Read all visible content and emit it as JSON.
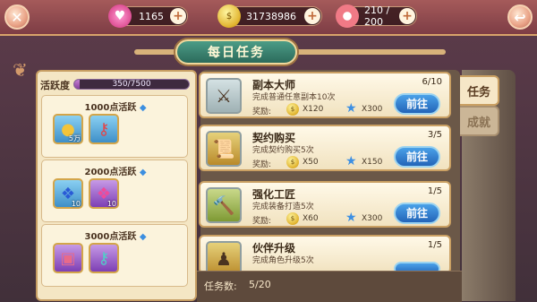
{
  "top_bar": {
    "close_icon": "close-icon",
    "back_icon": "back-icon",
    "resources": [
      {
        "icon": "heart-gem-icon",
        "value": "1165"
      },
      {
        "icon": "gold-coin-icon",
        "value": "31738986"
      },
      {
        "icon": "donut-stamina-icon",
        "value": "210 / 200"
      }
    ]
  },
  "panel": {
    "title": "每日任务"
  },
  "activity": {
    "label": "活跃度",
    "progress_text": "350/7500",
    "progress_fraction": 0.047,
    "tiers": [
      {
        "label": "1000点活跃",
        "items": [
          {
            "icon": "gold-medal-icon",
            "count": "5万"
          },
          {
            "icon": "red-key-icon",
            "count": ""
          }
        ]
      },
      {
        "label": "2000点活跃",
        "items": [
          {
            "icon": "blue-candy-icon",
            "count": "10"
          },
          {
            "icon": "purple-candy-icon",
            "count": "10"
          }
        ]
      },
      {
        "label": "3000点活跃",
        "items": [
          {
            "icon": "treasure-chest-icon",
            "count": ""
          },
          {
            "icon": "purple-key-icon",
            "count": ""
          }
        ]
      }
    ]
  },
  "tasks": [
    {
      "name": "副本大师",
      "desc": "完成普通任意副本10次",
      "progress": "6/10",
      "reward_label": "奖励:",
      "coin": "X120",
      "star": "X300",
      "button": "前往",
      "icon": "sword-shield-icon"
    },
    {
      "name": "契约购买",
      "desc": "完成契约购买5次",
      "progress": "3/5",
      "reward_label": "奖励:",
      "coin": "X50",
      "star": "X150",
      "button": "前往",
      "icon": "contract-chest-icon"
    },
    {
      "name": "强化工匠",
      "desc": "完成装备打造5次",
      "progress": "1/5",
      "reward_label": "奖励:",
      "coin": "X60",
      "star": "X300",
      "button": "前往",
      "icon": "anvil-chest-icon"
    },
    {
      "name": "伙伴升级",
      "desc": "完成角色升级5次",
      "progress": "1/5",
      "reward_label": "",
      "coin": "",
      "star": "",
      "button": "",
      "icon": "partner-chest-icon"
    }
  ],
  "footer": {
    "task_count_label": "任务数:",
    "task_count_value": "5/20"
  },
  "side_tabs": [
    {
      "label": "任务",
      "active": true
    },
    {
      "label": "成就",
      "active": false
    }
  ],
  "colors": {
    "accent_blue": "#2f7fd6",
    "title_green": "#3a8a76",
    "panel_cream": "#f4e6c4"
  }
}
